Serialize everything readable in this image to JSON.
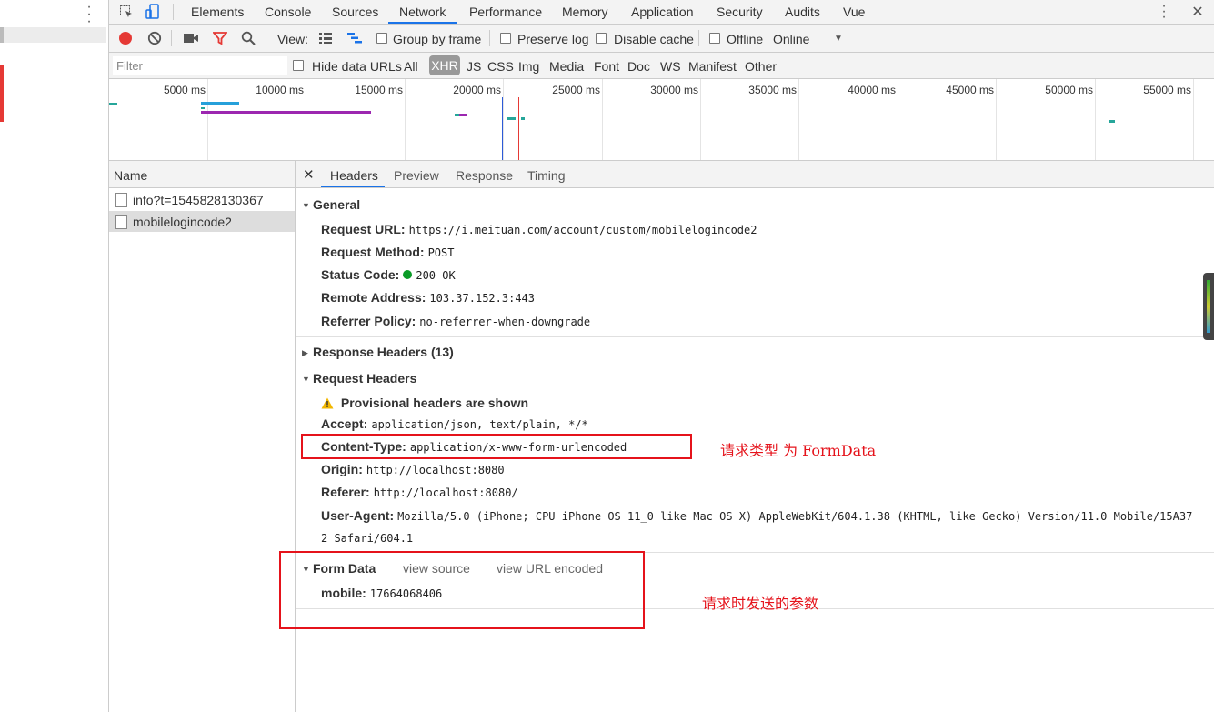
{
  "devtools": {
    "tabs": [
      "Elements",
      "Console",
      "Sources",
      "Network",
      "Performance",
      "Memory",
      "Application",
      "Security",
      "Audits",
      "Vue"
    ],
    "active_tab": "Network"
  },
  "toolbar": {
    "view_label": "View:",
    "group_by_frame": "Group by frame",
    "preserve_log": "Preserve log",
    "disable_cache": "Disable cache",
    "offline": "Offline",
    "throttle": "Online"
  },
  "filter": {
    "placeholder": "Filter",
    "hide_data_urls": "Hide data URLs",
    "types": [
      "All",
      "XHR",
      "JS",
      "CSS",
      "Img",
      "Media",
      "Font",
      "Doc",
      "WS",
      "Manifest",
      "Other"
    ],
    "active_type": "XHR"
  },
  "timeline": {
    "ticks": [
      "5000 ms",
      "10000 ms",
      "15000 ms",
      "20000 ms",
      "25000 ms",
      "30000 ms",
      "35000 ms",
      "40000 ms",
      "45000 ms",
      "50000 ms",
      "55000 ms"
    ]
  },
  "requests": {
    "header": "Name",
    "items": [
      {
        "name": "info?t=1545828130367"
      },
      {
        "name": "mobilelogincode2"
      }
    ]
  },
  "detail": {
    "tabs": [
      "Headers",
      "Preview",
      "Response",
      "Timing"
    ],
    "active_tab": "Headers",
    "general": {
      "title": "General",
      "request_url_k": "Request URL:",
      "request_url_v": "https://i.meituan.com/account/custom/mobilelogincode2",
      "method_k": "Request Method:",
      "method_v": "POST",
      "status_k": "Status Code:",
      "status_v": "200 OK",
      "remote_k": "Remote Address:",
      "remote_v": "103.37.152.3:443",
      "referrer_policy_k": "Referrer Policy:",
      "referrer_policy_v": "no-referrer-when-downgrade"
    },
    "response_headers": {
      "title": "Response Headers (13)"
    },
    "request_headers": {
      "title": "Request Headers",
      "warning": "Provisional headers are shown",
      "accept_k": "Accept:",
      "accept_v": "application/json, text/plain, */*",
      "content_type_k": "Content-Type:",
      "content_type_v": "application/x-www-form-urlencoded",
      "origin_k": "Origin:",
      "origin_v": "http://localhost:8080",
      "referer_k": "Referer:",
      "referer_v": "http://localhost:8080/",
      "ua_k": "User-Agent:",
      "ua_v_line1": "Mozilla/5.0 (iPhone; CPU iPhone OS 11_0 like Mac OS X) AppleWebKit/604.1.38 (KHTML, like Gecko) Version/11.0 Mobile/15A37",
      "ua_v_line2": "2 Safari/604.1"
    },
    "form_data": {
      "title": "Form Data",
      "view_source": "view source",
      "view_url_encoded": "view URL encoded",
      "mobile_k": "mobile:",
      "mobile_v": "17664068406"
    }
  },
  "annotations": {
    "content_type_note": "请求类型 为 FormData",
    "form_data_note": "请求时发送的参数"
  },
  "colors": {
    "accent": "#1a73e8",
    "record": "#e53935",
    "annotation": "#e5131b",
    "status_ok": "#0a9b27"
  }
}
